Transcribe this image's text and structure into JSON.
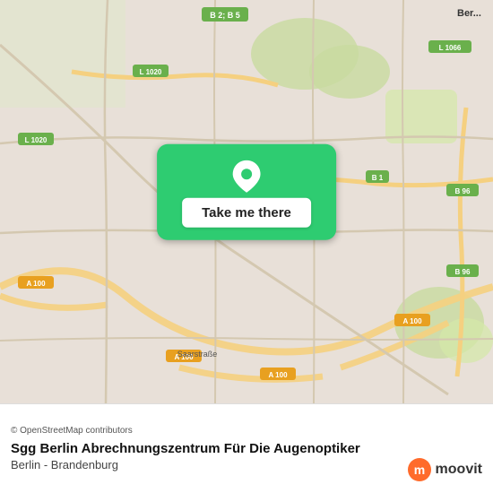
{
  "map": {
    "alt": "Map of Berlin showing location"
  },
  "button": {
    "label": "Take me there"
  },
  "footer": {
    "attribution": "© OpenStreetMap contributors",
    "title": "Sgg Berlin Abrechnungszentrum Für Die Augenoptiker",
    "subtitle": "Berlin - Brandenburg"
  },
  "moovit": {
    "label": "moovit"
  },
  "icons": {
    "pin": "📍"
  }
}
